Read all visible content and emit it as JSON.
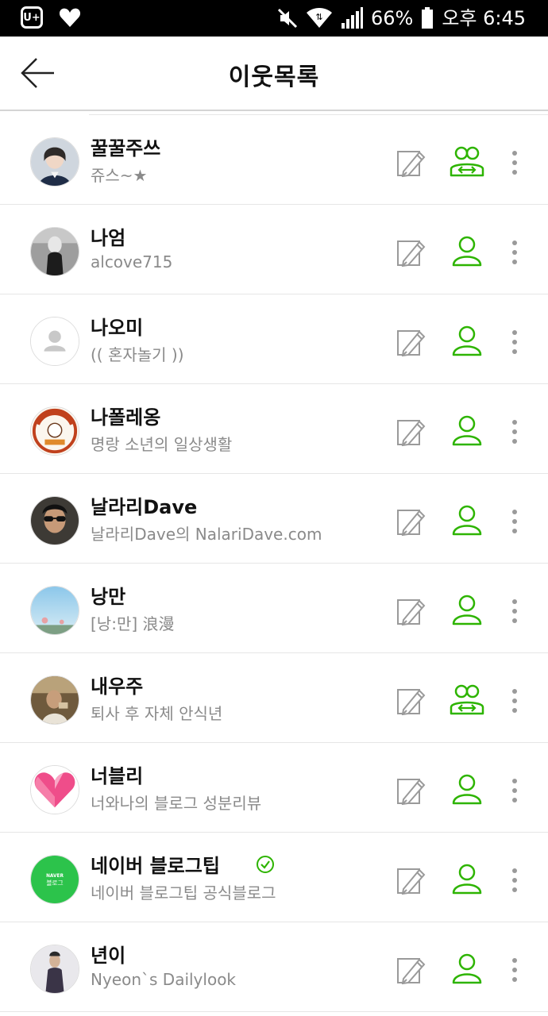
{
  "statusbar": {
    "battery": "66%",
    "time": "오후 6:45",
    "carrier_logo": "U+"
  },
  "header": {
    "title": "이웃목록"
  },
  "colors": {
    "accent": "#2db400",
    "text": "#111111",
    "subtext": "#8a8a8a",
    "icon_gray": "#9a9a9a"
  },
  "neighbors": [
    {
      "name": "꿀꿀주쓰",
      "desc": "쥬스~★",
      "relation": "mutual",
      "avatar": "photo-girl"
    },
    {
      "name": "나엄",
      "desc": "alcove715",
      "relation": "single",
      "avatar": "photo-bw"
    },
    {
      "name": "나오미",
      "desc": "(( 혼자놀기 ))",
      "relation": "single",
      "avatar": "default-person"
    },
    {
      "name": "나폴레옹",
      "desc": "명랑 소년의 일상생활",
      "relation": "single",
      "avatar": "stamp-logo"
    },
    {
      "name": "날라리Dave",
      "desc": "날라리Dave의 NalariDave.com",
      "relation": "single",
      "avatar": "photo-sunglasses"
    },
    {
      "name": "낭만",
      "desc": "[낭:만] 浪漫",
      "relation": "single",
      "avatar": "photo-sky"
    },
    {
      "name": "내우주",
      "desc": "퇴사 후 자체 안식년",
      "relation": "mutual",
      "avatar": "photo-brown"
    },
    {
      "name": "너블리",
      "desc": "너와나의 블로그 성분리뷰",
      "relation": "single",
      "avatar": "pink-heart"
    },
    {
      "name": "네이버 블로그팁",
      "desc": "네이버 블로그팁 공식블로그",
      "relation": "single",
      "avatar": "naver-green",
      "verified": true,
      "avatar_label_top": "NAVER",
      "avatar_label": "블로그"
    },
    {
      "name": "년이",
      "desc": "Nyeon`s Dailylook",
      "relation": "single",
      "avatar": "photo-person"
    }
  ]
}
